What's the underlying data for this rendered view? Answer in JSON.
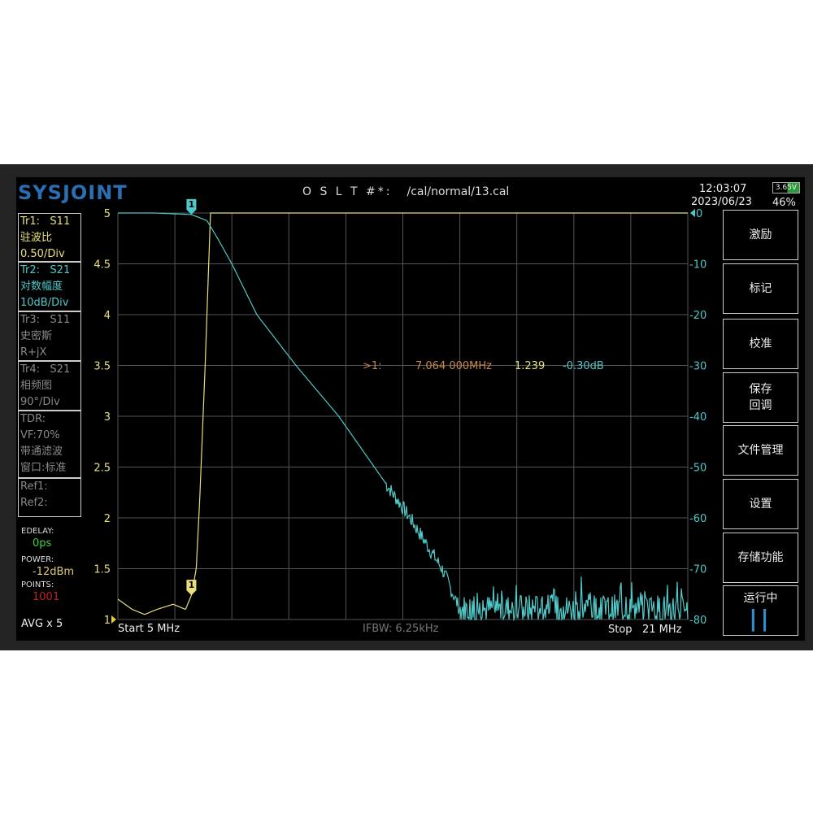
{
  "header": {
    "logo": "SYSJOINT",
    "cal_label": "O S L T #*:",
    "cal_file": "/cal/normal/13.cal",
    "time": "12:03:07",
    "date": "2023/06/23",
    "battery_voltage": "3.65V",
    "battery_percent": "46%"
  },
  "traces": [
    {
      "lines": [
        "Tr1:   S11",
        "驻波比",
        "0.50/Div"
      ],
      "color": "#e8e07a"
    },
    {
      "lines": [
        "Tr2:   S21",
        "对数幅度",
        "10dB/Div"
      ],
      "color": "#4fc9c9"
    },
    {
      "lines": [
        "Tr3:   S11",
        "史密斯",
        "R+jX"
      ],
      "color": "#888888"
    },
    {
      "lines": [
        "Tr4:   S21",
        "相频图",
        "90°/Div"
      ],
      "color": "#888888"
    },
    {
      "lines": [
        "TDR:",
        "VF:70%",
        "带通滤波",
        "窗口:标准"
      ],
      "color": "#888888"
    },
    {
      "lines": [
        "Ref1:",
        "Ref2:"
      ],
      "color": "#888888"
    }
  ],
  "status": {
    "edelay_label": "EDELAY:",
    "edelay": "0ps",
    "power_label": "POWER:",
    "power": "-12dBm",
    "points_label": "POINTS:",
    "points": "1001",
    "avg": "AVG x 5"
  },
  "buttons": [
    [
      "激励"
    ],
    [
      "标记"
    ],
    [
      "校准"
    ],
    [
      "保存",
      "回调"
    ],
    [
      "文件管理"
    ],
    [
      "设置"
    ],
    [
      "存储功能"
    ],
    [
      "运行中",
      "||"
    ]
  ],
  "footer": {
    "start": "Start   5 MHz",
    "ifbw": "IFBW: 6.25kHz",
    "stop": "Stop   21 MHz"
  },
  "marker_readout": {
    "id": ">1:",
    "freq": "7.064 000MHz",
    "s11": "1.239",
    "s21": "-0.30dB",
    "marker_label": "1"
  },
  "chart_data": {
    "type": "line",
    "x_range_mhz": [
      5,
      21
    ],
    "left_axis": {
      "ticks": [
        "5",
        "4.5",
        "4",
        "3.5",
        "3",
        "2.5",
        "2",
        "1.5",
        "1"
      ],
      "range": [
        1,
        5
      ]
    },
    "right_axis": {
      "ticks": [
        "0",
        "-10",
        "-20",
        "-30",
        "-40",
        "-50",
        "-60",
        "-70",
        "-80"
      ],
      "range": [
        -80,
        0
      ]
    },
    "series": [
      {
        "name": "S11 VSWR",
        "axis": "left",
        "color": "#e8e07a",
        "points": [
          [
            5,
            1.2
          ],
          [
            5.4,
            1.1
          ],
          [
            5.75,
            1.05
          ],
          [
            6.1,
            1.1
          ],
          [
            6.55,
            1.15
          ],
          [
            6.9,
            1.1
          ],
          [
            7.064,
            1.239
          ],
          [
            7.2,
            1.5
          ],
          [
            7.3,
            2.2
          ],
          [
            7.45,
            3.5
          ],
          [
            7.55,
            4.5
          ],
          [
            7.6,
            5
          ],
          [
            21,
            5
          ]
        ]
      },
      {
        "name": "S21 LogMag",
        "axis": "right",
        "color": "#4fc9c9",
        "points": [
          [
            5,
            0
          ],
          [
            6,
            0
          ],
          [
            7.064,
            -0.3
          ],
          [
            7.5,
            -1.5
          ],
          [
            7.8,
            -5
          ],
          [
            8.2,
            -10
          ],
          [
            8.9,
            -20
          ],
          [
            10,
            -30
          ],
          [
            11.2,
            -40
          ],
          [
            12.2,
            -50
          ],
          [
            13.2,
            -60
          ],
          [
            14.1,
            -70
          ],
          [
            14.6,
            -78
          ],
          [
            21,
            -78
          ]
        ],
        "noise_floor_db": [
          -80,
          -74
        ]
      }
    ]
  }
}
